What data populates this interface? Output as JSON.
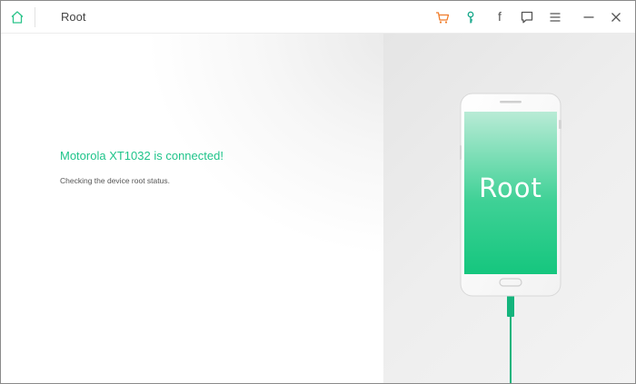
{
  "app": {
    "title": "Root"
  },
  "toolbar": {
    "icons": [
      "home-icon",
      "cart-icon",
      "key-icon",
      "facebook-icon",
      "feedback-icon",
      "menu-icon",
      "minimize-icon",
      "close-icon"
    ],
    "facebook_glyph": "f"
  },
  "main": {
    "headline": "Motorola XT1032 is connected!",
    "status": "Checking the device root status."
  },
  "phone": {
    "screen_text": "Root"
  },
  "colors": {
    "accent": "#1fc48a",
    "cart": "#f07c2a",
    "key": "#18a88b",
    "screen_top": "#b9ebd6",
    "screen_bottom": "#15c67e"
  }
}
